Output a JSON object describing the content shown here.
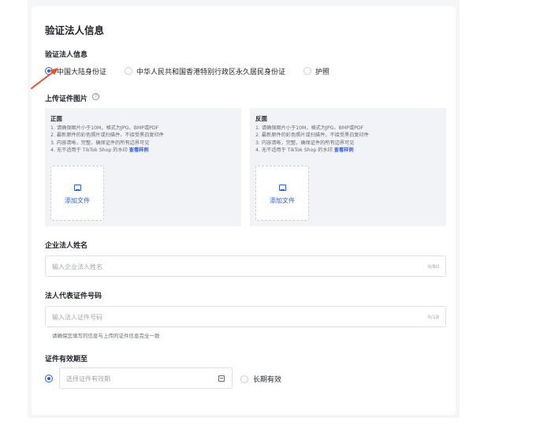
{
  "page_title": "验证法人信息",
  "verify_section": {
    "label": "验证法人信息",
    "options": [
      {
        "label": "中国大陆身份证",
        "selected": true
      },
      {
        "label": "中华人民共和国香港特别行政区永久居民身份证",
        "selected": false
      },
      {
        "label": "护照",
        "selected": false
      }
    ]
  },
  "upload_section": {
    "label": "上传证件图片",
    "help_icon": "?",
    "panels": [
      {
        "title": "正面",
        "requirements": [
          "1. 请确保图片小于10M，格式为JPG、BMP或PDF",
          "2. 最新原件的彩色照片或扫描件，不接受黑白复印件",
          "3. 内容清晰，完整，确保证件的所有边界可见"
        ],
        "req4_text": "4. 无不适用于 TikTok Shop 的水印",
        "req4_link": "查看样例",
        "add_file_label": "添加文件"
      },
      {
        "title": "反面",
        "requirements": [
          "1. 请确保图片小于10M，格式为JPG、BMP或PDF",
          "2. 最新原件的彩色照片或扫描件，不接受黑白复印件",
          "3. 内容清晰，完整，确保证件的所有边界可见"
        ],
        "req4_text": "4. 无不适用于 TikTok Shop 的水印",
        "req4_link": "查看样例",
        "add_file_label": "添加文件"
      }
    ]
  },
  "legal_name": {
    "label": "企业法人姓名",
    "placeholder": "输入企业法人姓名",
    "counter": "0/80"
  },
  "id_number": {
    "label": "法人代表证件号码",
    "placeholder": "输入法人证件号码",
    "counter": "0/18",
    "hint": "请确保您填写的信息与上传的证件信息完全一致"
  },
  "validity": {
    "label": "证件有效期至",
    "date_placeholder": "选择证件有效期",
    "long_term_label": "长期有效",
    "date_selected": true
  },
  "colors": {
    "accent": "#2b5af6",
    "annotation_arrow": "#e8512a"
  }
}
